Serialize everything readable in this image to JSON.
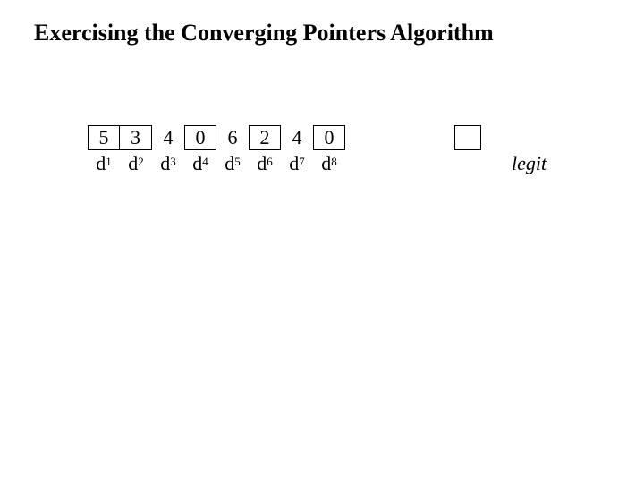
{
  "title": "Exercising the Converging Pointers Algorithm",
  "cells": {
    "c0": "5",
    "c1": "3",
    "c2": "4",
    "c3": "0",
    "c4": "6",
    "c5": "2",
    "c6": "4",
    "c7": "0"
  },
  "labels": {
    "base": "d",
    "s0": "1",
    "s1": "2",
    "s2": "3",
    "s3": "4",
    "s4": "5",
    "s5": "6",
    "s6": "7",
    "s7": "8"
  },
  "legit_label": "legit"
}
